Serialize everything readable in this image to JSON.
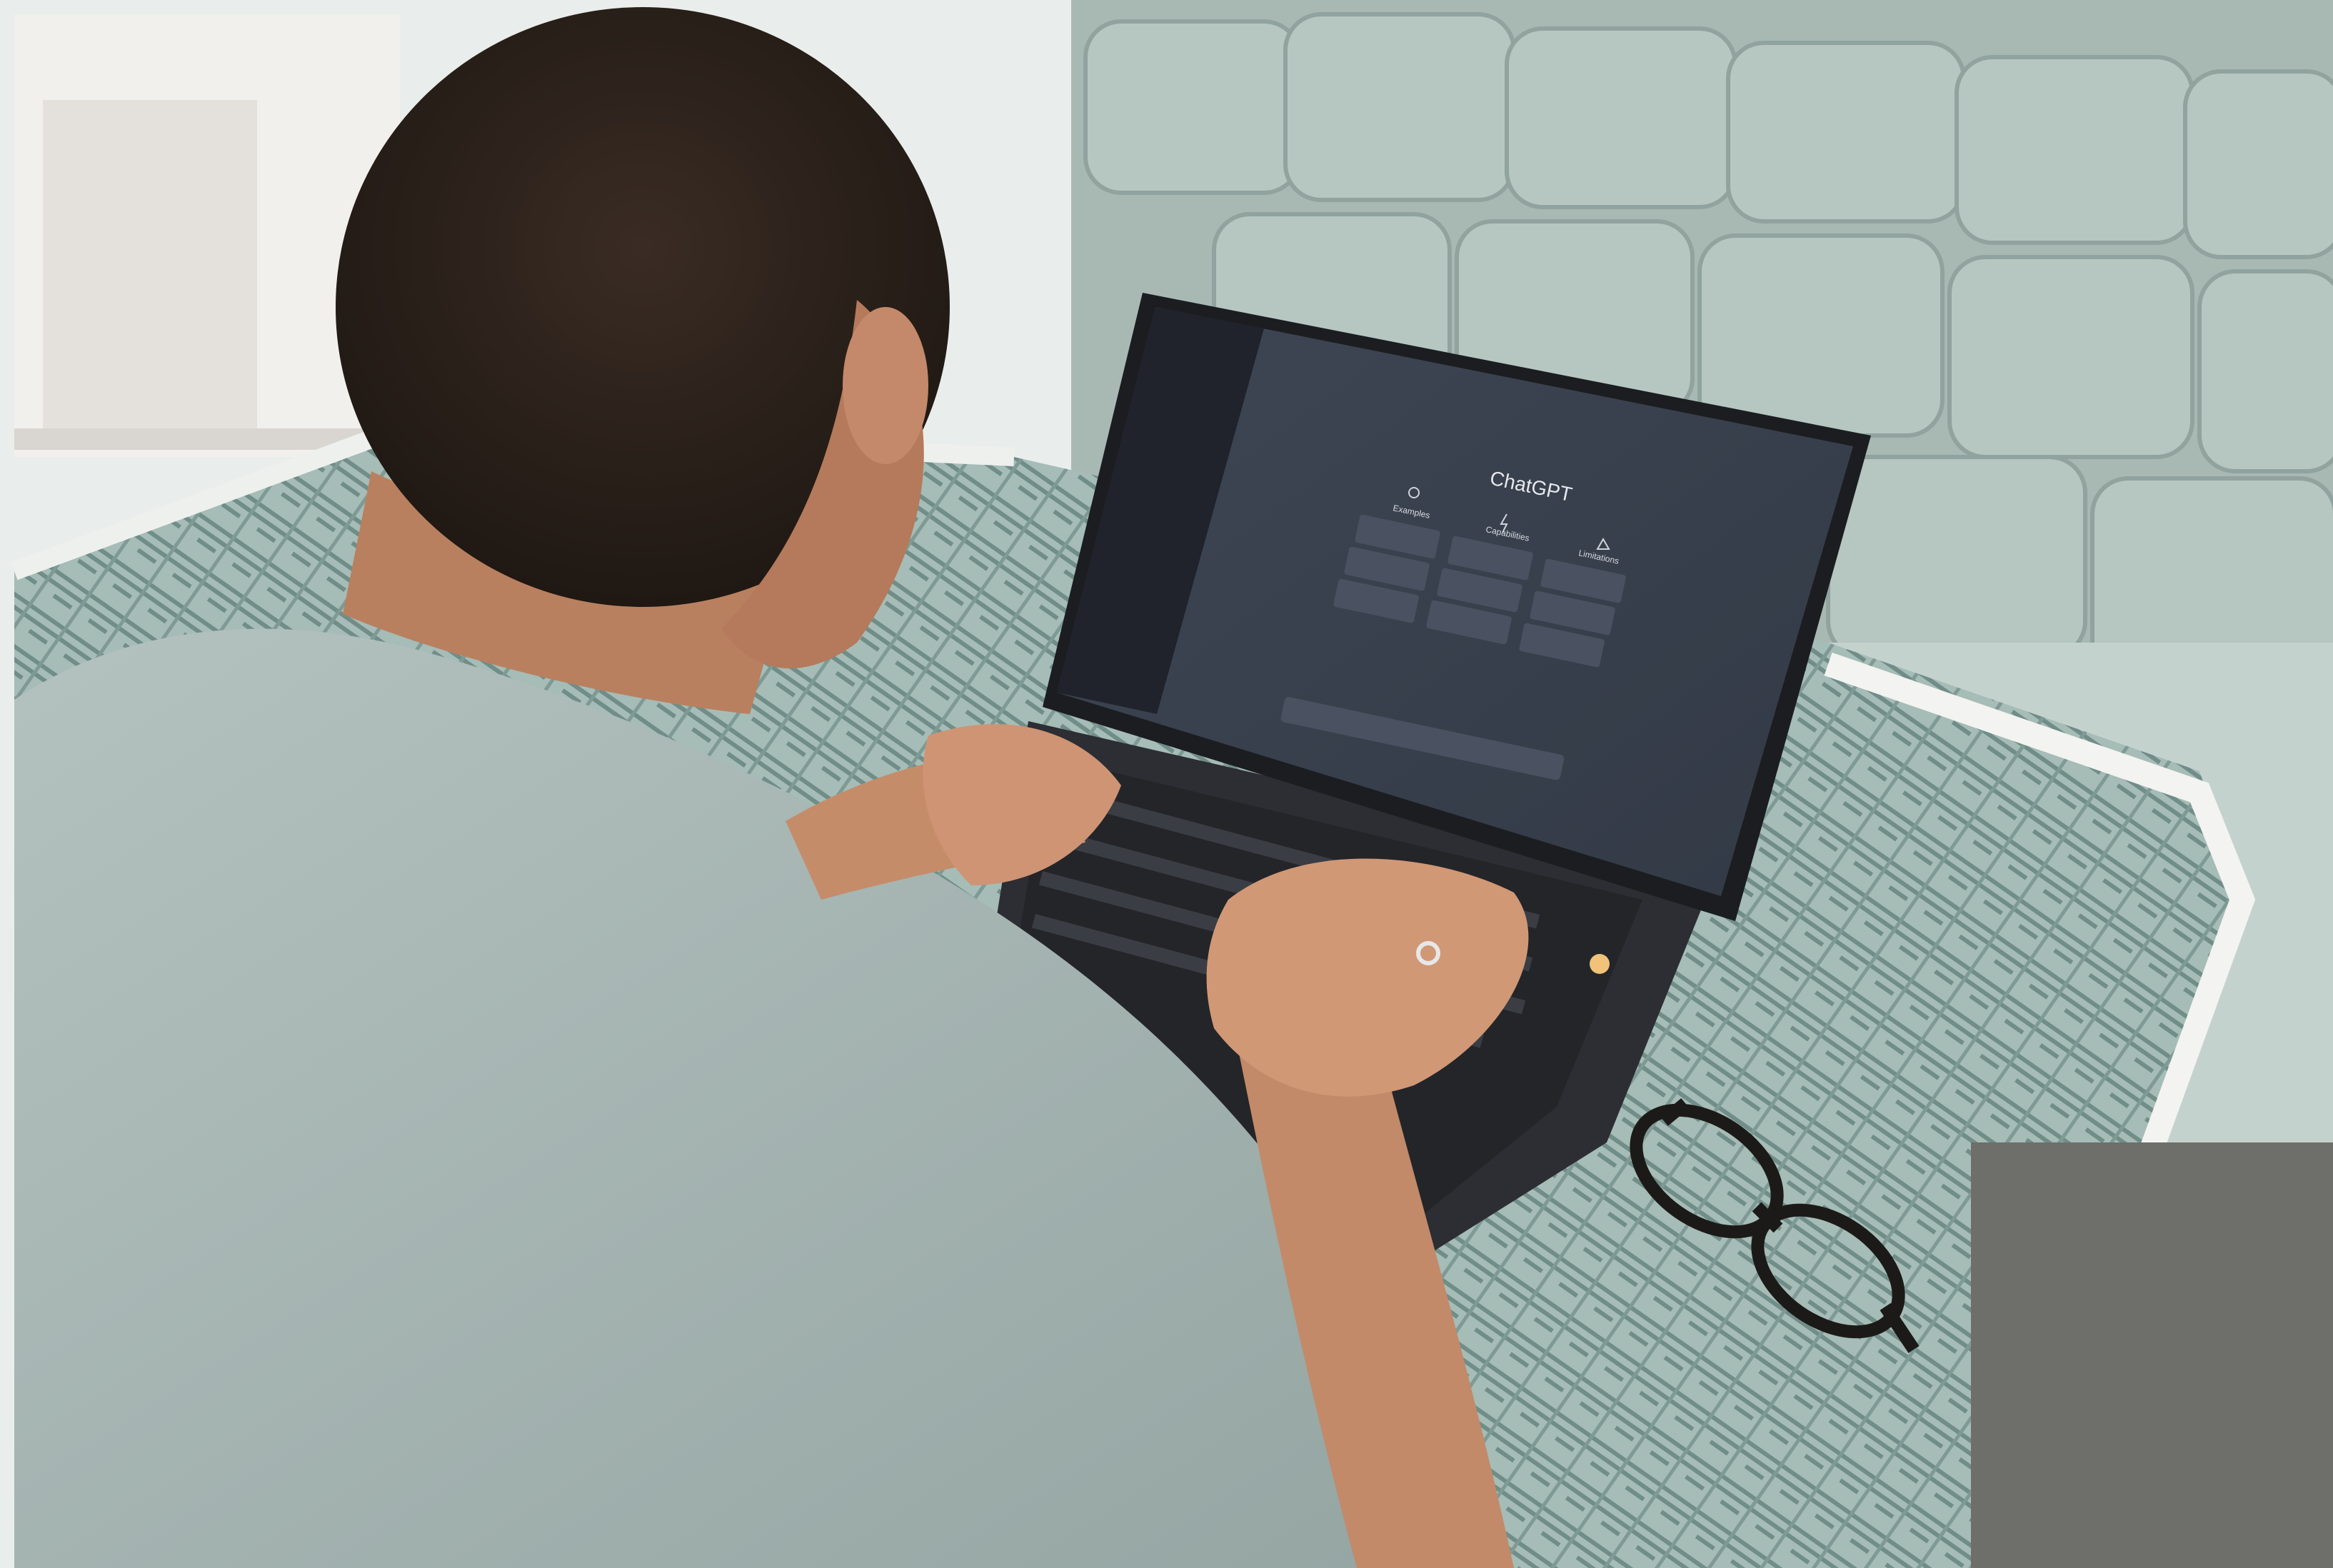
{
  "screen": {
    "app_title": "ChatGPT",
    "columns": [
      {
        "heading": "Examples",
        "icon": "sun-icon"
      },
      {
        "heading": "Capabilities",
        "icon": "lightning-icon"
      },
      {
        "heading": "Limitations",
        "icon": "warning-triangle-icon"
      }
    ]
  },
  "colors": {
    "wall": "#eef1ef",
    "sofa": "#a9bab5",
    "table_top": "#9fb7b1",
    "table_pattern": "#6f8c87",
    "shirt": "#aab9b6",
    "skin": "#c98f6d",
    "hair": "#2f241e",
    "laptop_body": "#2b2d31",
    "laptop_screen": "#3a4250",
    "sidebar": "#20232b",
    "card": "#4a5261"
  }
}
